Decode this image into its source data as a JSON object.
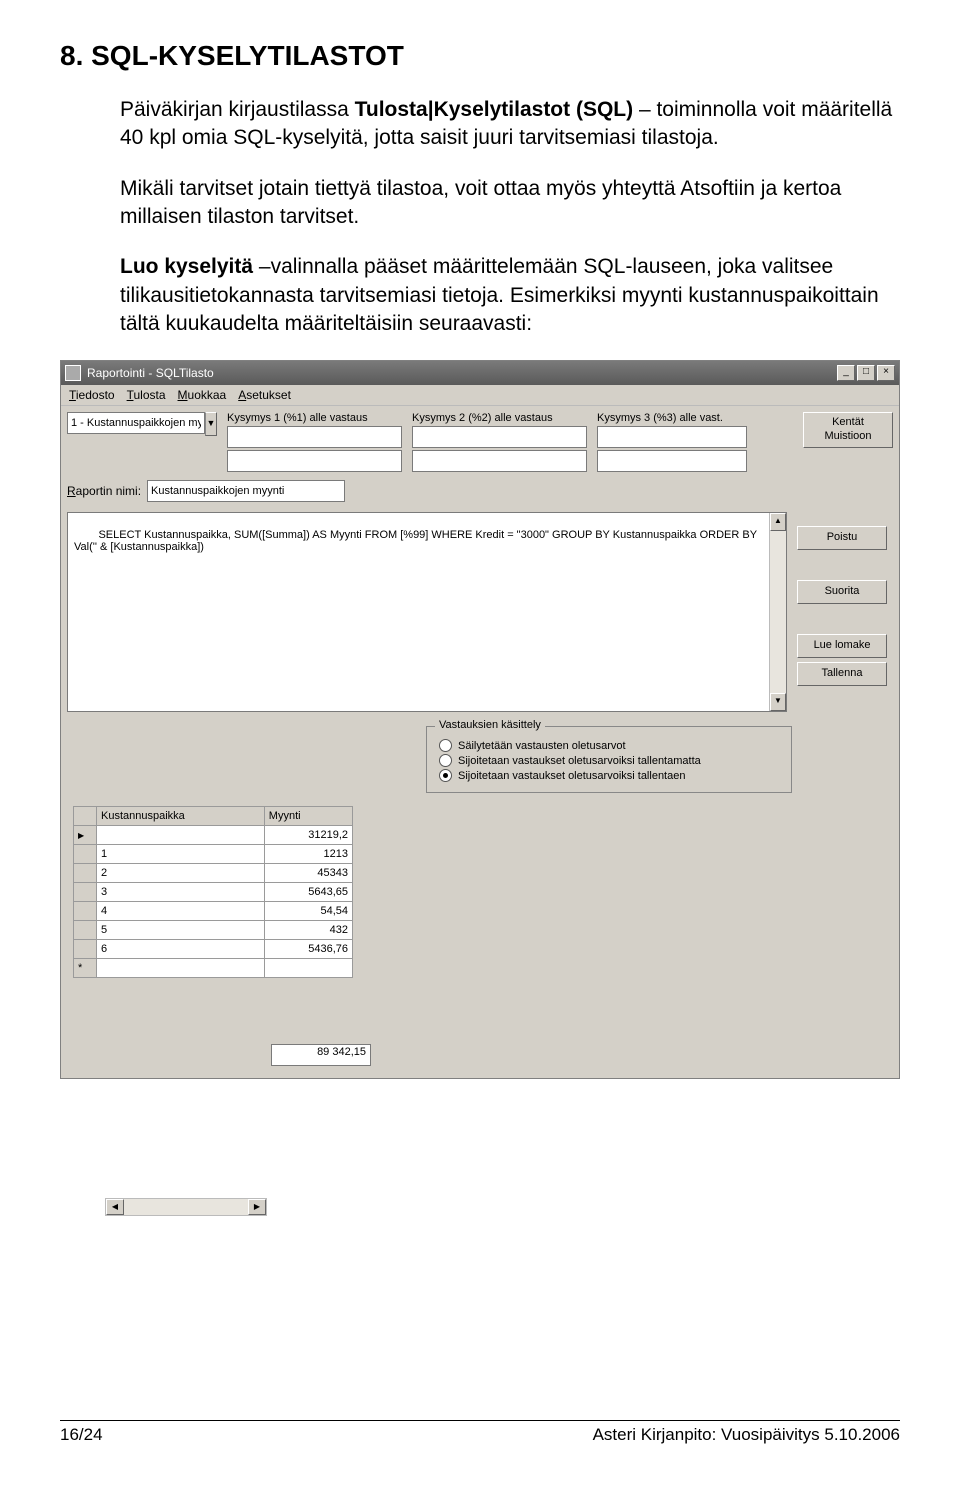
{
  "heading": "8. SQL-KYSELYTILASTOT",
  "p1_a": "Päiväkirjan kirjaustilassa ",
  "p1_b": "Tulosta|Kyselytilastot (SQL)",
  "p1_c": " – toiminnolla voit määritellä 40 kpl omia SQL-kyselyitä, jotta saisit juuri tarvitsemiasi tilastoja.",
  "p2": "Mikäli tarvitset jotain tiettyä tilastoa, voit ottaa myös yhteyttä Atsoftiin ja kertoa millaisen tilaston tarvitset.",
  "p3_a": "Luo kyselyitä",
  "p3_b": " –valinnalla pääset määrittelemään SQL-lauseen, joka valitsee tilikausitietokannasta tarvitsemiasi tietoja. Esimerkiksi myynti kustannuspaikoittain tältä kuukaudelta määriteltäisiin seuraavasti:",
  "window": {
    "title": "Raportointi - SQLTilasto",
    "menu": [
      "Tiedosto",
      "Tulosta",
      "Muokkaa",
      "Asetukset"
    ],
    "menu_u": [
      "T",
      "T",
      "M",
      "A"
    ],
    "combo_value": "1 - Kustannuspaikkojen my",
    "q1_label": "Kysymys 1 (%1) alle vastaus",
    "q2_label": "Kysymys 2 (%2) alle vastaus",
    "q3_label": "Kysymys 3 (%3) alle vast.",
    "reportname_label": "Raportin nimi:",
    "reportname_label_u": "R",
    "reportname_value": "Kustannuspaikkojen myynti",
    "sql": "SELECT Kustannuspaikka, SUM([Summa]) AS Myynti FROM [%99] WHERE Kredit = \"3000\" GROUP BY Kustannuspaikka ORDER BY Val('' & [Kustannuspaikka])",
    "buttons": {
      "kentat": "Kentät Muistioon",
      "poistu": "Poistu",
      "suorita": "Suorita",
      "lue": "Lue lomake",
      "tallenna": "Tallenna"
    },
    "radio": {
      "legend": "Vastauksien käsittely",
      "opt1": "Säilytetään vastausten oletusarvot",
      "opt2": "Sijoitetaan vastaukset oletusarvoiksi tallentamatta",
      "opt3": "Sijoitetaan vastaukset oletusarvoiksi tallentaen"
    },
    "table": {
      "headers": [
        "Kustannuspaikka",
        "Myynti"
      ],
      "rows": [
        [
          "",
          "31219,2"
        ],
        [
          "1",
          "1213"
        ],
        [
          "2",
          "45343"
        ],
        [
          "3",
          "5643,65"
        ],
        [
          "4",
          "54,54"
        ],
        [
          "5",
          "432"
        ],
        [
          "6",
          "5436,76"
        ]
      ],
      "total": "89 342,15"
    }
  },
  "footer": {
    "left": "16/24",
    "right": "Asteri Kirjanpito: Vuosipäivitys 5.10.2006"
  }
}
